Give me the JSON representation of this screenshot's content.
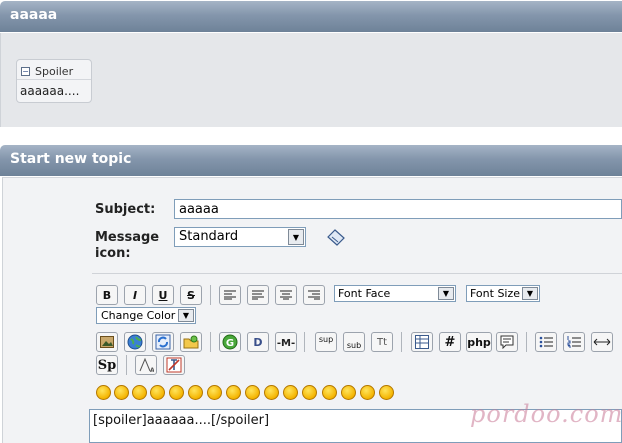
{
  "preview": {
    "title": "aaaaa",
    "spoiler_label": "Spoiler",
    "spoiler_content": "aaaaaa...."
  },
  "form": {
    "header": "Start new topic",
    "subject_label": "Subject:",
    "subject_value": "aaaaa",
    "icon_label": "Message icon:",
    "icon_value": "Standard"
  },
  "toolbar": {
    "font_face": "Font Face",
    "font_size": "Font Size",
    "change_color": "Change Color",
    "sup": "sup",
    "sub": "sub",
    "tt": "Tt",
    "php": "php",
    "hash": "#",
    "sp": "Sp"
  },
  "editor": {
    "content": "[spoiler]aaaaaa....[/spoiler]"
  },
  "watermark": "pordoo.com"
}
